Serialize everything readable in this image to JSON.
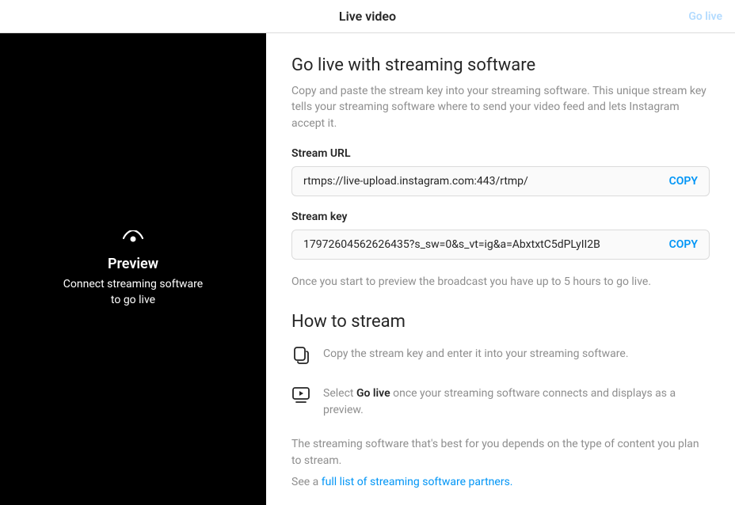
{
  "header": {
    "title": "Live video",
    "go_live": "Go live"
  },
  "preview": {
    "title": "Preview",
    "subtitle_line1": "Connect streaming software",
    "subtitle_line2": "to go live"
  },
  "main": {
    "heading": "Go live with streaming software",
    "description": "Copy and paste the stream key into your streaming software. This unique stream key tells your streaming software where to send your video feed and lets Instagram accept it.",
    "stream_url_label": "Stream URL",
    "stream_url_value": "rtmps://live-upload.instagram.com:443/rtmp/",
    "stream_key_label": "Stream key",
    "stream_key_value": "17972604562626435?s_sw=0&s_vt=ig&a=AbxtxtC5dPLyII2B",
    "copy_label": "COPY",
    "preview_note": "Once you start to preview the broadcast you have up to 5 hours to go live.",
    "how_to_heading": "How to stream",
    "step1": "Copy the stream key and enter it into your streaming software.",
    "step2_prefix": "Select ",
    "step2_bold": "Go live",
    "step2_suffix": " once your streaming software connects and displays as a preview.",
    "footer1": "The streaming software that's best for you depends on the type of content you plan to stream.",
    "footer2_prefix": "See a ",
    "footer2_link": "full list of streaming software partners.",
    "colors": {
      "link": "#0095f6",
      "disabled": "#b3dbff"
    }
  }
}
